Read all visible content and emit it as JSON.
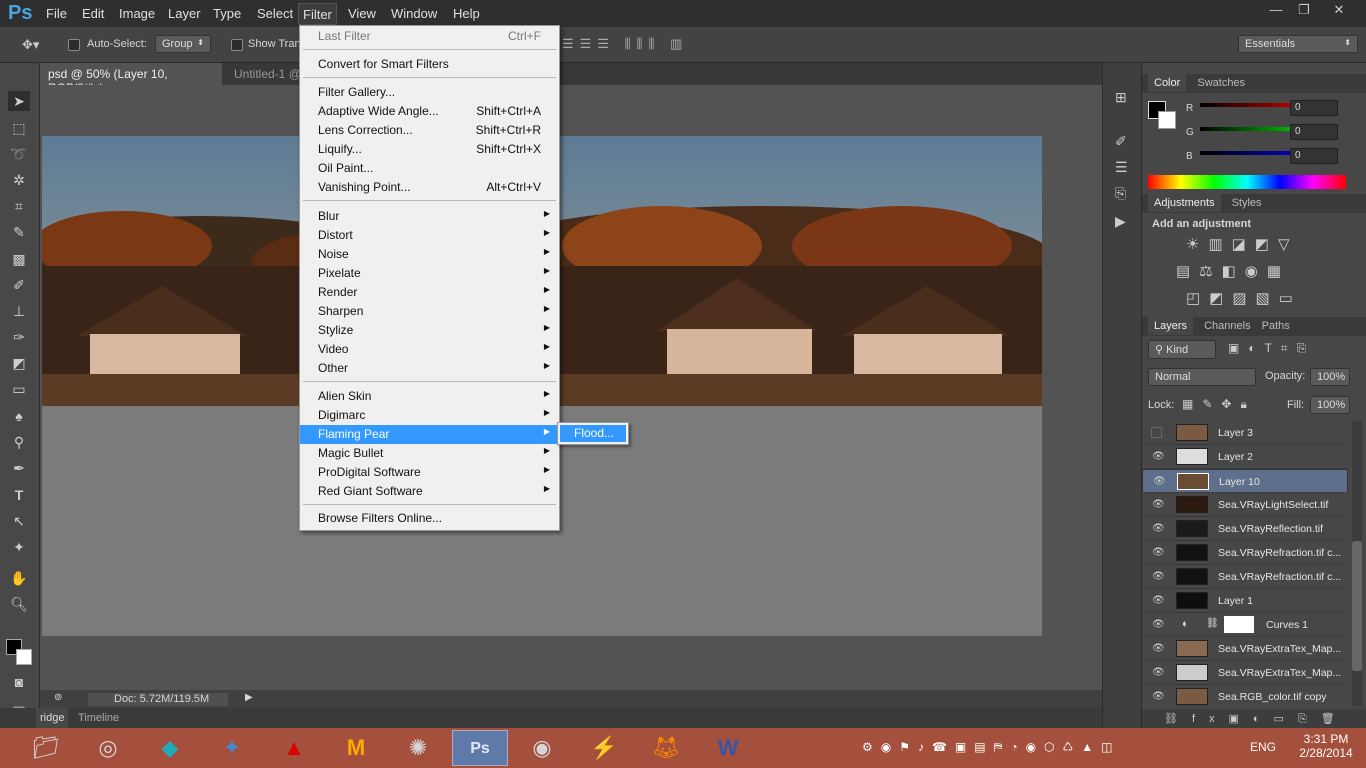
{
  "app": {
    "logo": "Ps"
  },
  "menubar": {
    "items": [
      "File",
      "Edit",
      "Image",
      "Layer",
      "Type",
      "Select",
      "Filter",
      "View",
      "Window",
      "Help"
    ],
    "win_min": "—",
    "win_max": "❐",
    "win_close": "✕"
  },
  "options": {
    "auto_select": "Auto-Select:",
    "group_value": "Group",
    "show_transform": "Show Tran",
    "workspace": "Essentials"
  },
  "tabs": {
    "active": "psd @ 50% (Layer 10, RGB/8#) *",
    "active_close": "×",
    "second": "Untitled-1 @"
  },
  "status": {
    "doc": "Doc: 5.72M/119.5M"
  },
  "bottom_tabs": {
    "bridge": "ridge",
    "timeline": "Timeline"
  },
  "filter_menu": {
    "last_filter": {
      "label": "Last Filter",
      "shortcut": "Ctrl+F"
    },
    "convert": "Convert for Smart Filters",
    "group1": [
      {
        "label": "Filter Gallery...",
        "shortcut": ""
      },
      {
        "label": "Adaptive Wide Angle...",
        "shortcut": "Shift+Ctrl+A"
      },
      {
        "label": "Lens Correction...",
        "shortcut": "Shift+Ctrl+R"
      },
      {
        "label": "Liquify...",
        "shortcut": "Shift+Ctrl+X"
      },
      {
        "label": "Oil Paint...",
        "shortcut": ""
      },
      {
        "label": "Vanishing Point...",
        "shortcut": "Alt+Ctrl+V"
      }
    ],
    "group2": [
      "Blur",
      "Distort",
      "Noise",
      "Pixelate",
      "Render",
      "Sharpen",
      "Stylize",
      "Video",
      "Other"
    ],
    "group3": [
      "Alien Skin",
      "Digimarc",
      "Flaming Pear",
      "Magic Bullet",
      "ProDigital Software",
      "Red Giant Software"
    ],
    "browse": "Browse Filters Online...",
    "submenu_flood": "Flood..."
  },
  "color_panel": {
    "tab_active": "Color",
    "tab2": "Swatches",
    "r_label": "R",
    "g_label": "G",
    "b_label": "B",
    "r": "0",
    "g": "0",
    "b": "0"
  },
  "adjustments": {
    "tab_active": "Adjustments",
    "tab2": "Styles",
    "heading": "Add an adjustment"
  },
  "layers_panel": {
    "tab_active": "Layers",
    "tab2": "Channels",
    "tab3": "Paths",
    "kind": "Kind",
    "blend": "Normal",
    "opacity_label": "Opacity:",
    "opacity": "100%",
    "lock_label": "Lock:",
    "fill_label": "Fill:",
    "fill": "100%",
    "layers": [
      "Layer 3",
      "Layer 2",
      "Layer 10",
      "Sea.VRayLightSelect.tif",
      "Sea.VRayReflection.tif",
      "Sea.VRayRefraction.tif c...",
      "Sea.VRayRefraction.tif c...",
      "Layer 1",
      "Curves 1",
      "Sea.VRayExtraTex_Map...",
      "Sea.VRayExtraTex_Map...",
      "Sea.RGB_color.tif copy"
    ]
  },
  "taskbar": {
    "lang": "ENG",
    "time": "3:31 PM",
    "date": "2/28/2014"
  },
  "colors": {
    "highlight": "#3399ff",
    "taskbar": "#a4503c",
    "layer_selected": "#5d6f8a"
  }
}
